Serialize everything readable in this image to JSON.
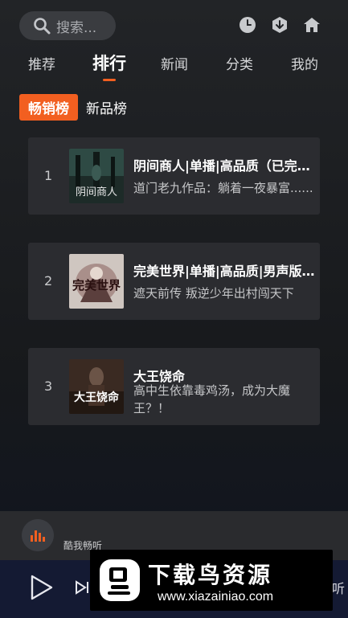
{
  "search": {
    "placeholder": "搜索..."
  },
  "tabs": [
    {
      "label": "推荐"
    },
    {
      "label": "排行"
    },
    {
      "label": "新闻"
    },
    {
      "label": "分类"
    },
    {
      "label": "我的"
    }
  ],
  "subtabs": [
    {
      "label": "畅销榜"
    },
    {
      "label": "新品榜"
    }
  ],
  "books": [
    {
      "rank": "1",
      "title": "阴间商人|单播|高品质（已完结）",
      "desc": "道门老九作品：躺着一夜暴富......",
      "cover_text": "阴间商人"
    },
    {
      "rank": "2",
      "title": "完美世界|单播|高品质|男声版|有声小说",
      "desc": "遮天前传 叛逆少年出村闯天下",
      "cover_text": "完美世界"
    },
    {
      "rank": "3",
      "title": "大王饶命",
      "desc": "高中生依靠毒鸡汤，成为大魔王？！",
      "cover_text": "大王饶命"
    }
  ],
  "brand": {
    "name": "酷我畅听"
  },
  "player": {
    "listen_label": "听"
  },
  "watermark": {
    "title": "下载鸟资源",
    "url": "www.xiazainiao.com"
  },
  "colors": {
    "accent": "#f25f20",
    "card": "#2b2c30",
    "player_bg": "#141a33"
  }
}
